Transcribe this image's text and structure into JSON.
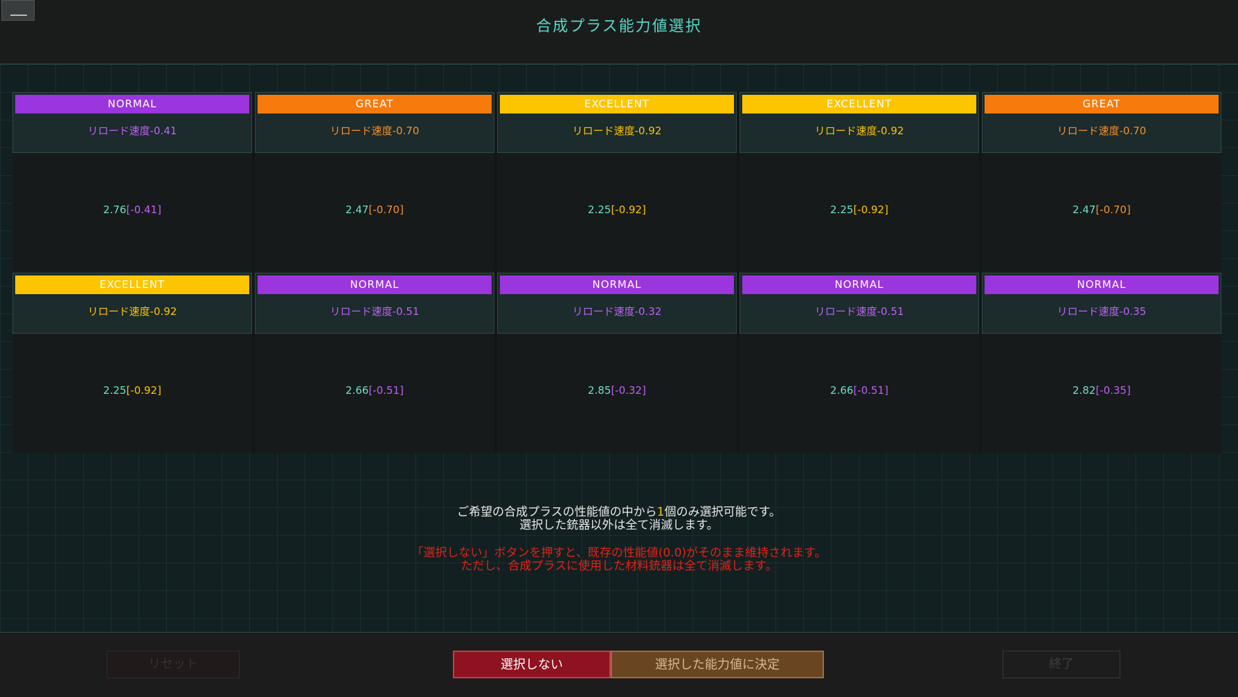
{
  "header": {
    "title": "合成プラス能力値選択"
  },
  "cards": [
    {
      "rank": "NORMAL",
      "stat": "リロード速度-0.41",
      "value": "2.76",
      "delta": "[-0.41]"
    },
    {
      "rank": "GREAT",
      "stat": "リロード速度-0.70",
      "value": "2.47",
      "delta": "[-0.70]"
    },
    {
      "rank": "EXCELLENT",
      "stat": "リロード速度-0.92",
      "value": "2.25",
      "delta": "[-0.92]"
    },
    {
      "rank": "EXCELLENT",
      "stat": "リロード速度-0.92",
      "value": "2.25",
      "delta": "[-0.92]"
    },
    {
      "rank": "GREAT",
      "stat": "リロード速度-0.70",
      "value": "2.47",
      "delta": "[-0.70]"
    },
    {
      "rank": "EXCELLENT",
      "stat": "リロード速度-0.92",
      "value": "2.25",
      "delta": "[-0.92]"
    },
    {
      "rank": "NORMAL",
      "stat": "リロード速度-0.51",
      "value": "2.66",
      "delta": "[-0.51]"
    },
    {
      "rank": "NORMAL",
      "stat": "リロード速度-0.32",
      "value": "2.85",
      "delta": "[-0.32]"
    },
    {
      "rank": "NORMAL",
      "stat": "リロード速度-0.51",
      "value": "2.66",
      "delta": "[-0.51]"
    },
    {
      "rank": "NORMAL",
      "stat": "リロード速度-0.35",
      "value": "2.82",
      "delta": "[-0.35]"
    }
  ],
  "info": {
    "line1_prefix": "ご希望の合成プラスの性能値の中から",
    "line1_count": "1",
    "line1_suffix": "個のみ選択可能です。",
    "line2": "選択した銃器以外は全て消滅します。",
    "warning1": "「選択しない」ボタンを押すと、既存の性能値(0.0)がそのまま維持されます。",
    "warning2": "ただし、合成プラスに使用した材料銃器は全て消滅します。"
  },
  "footer": {
    "reset_label": "リセット",
    "no_select_label": "選択しない",
    "confirm_label": "選択した能力値に決定",
    "end_label": "終了"
  },
  "colors": {
    "normal": "#9b35dd",
    "great": "#f77b0c",
    "excellent": "#fdc500",
    "title": "#58d8c8",
    "warning": "#e0231a"
  }
}
